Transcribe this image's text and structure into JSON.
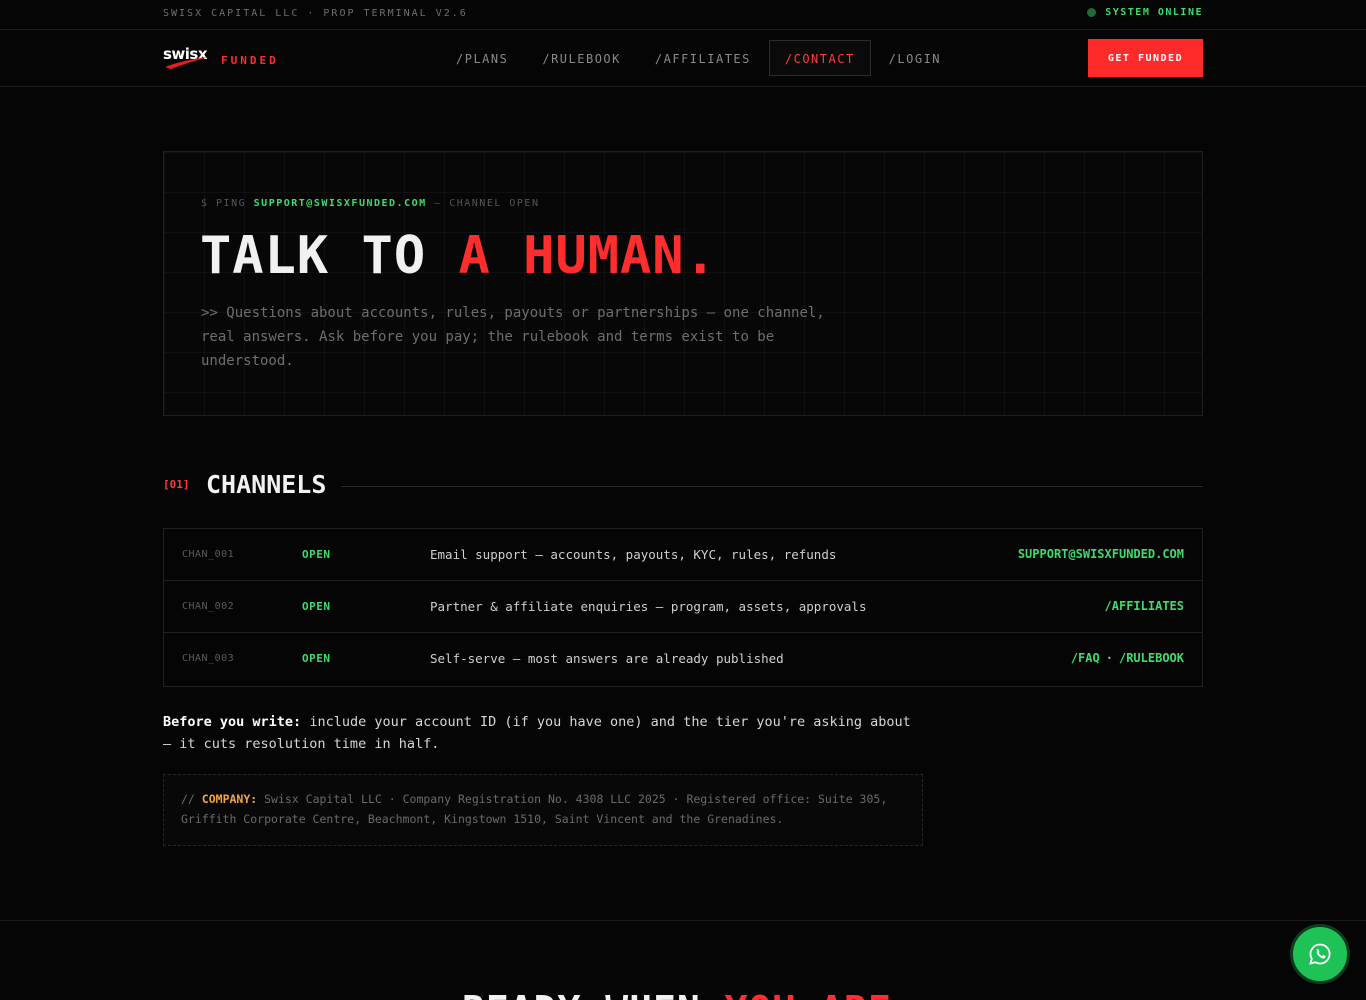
{
  "topbar": {
    "company": "SWISX CAPITAL LLC · PROP TERMINAL V2.6",
    "status": "SYSTEM ONLINE"
  },
  "nav": {
    "logo_word": "swisx",
    "logo_sub": "FUNDED",
    "links": [
      "/PLANS",
      "/RULEBOOK",
      "/AFFILIATES",
      "/CONTACT",
      "/LOGIN"
    ],
    "active": "/CONTACT",
    "cta": "GET FUNDED"
  },
  "hero": {
    "ping_prefix": "$ PING",
    "ping_email": "SUPPORT@SWISXFUNDED.COM",
    "ping_suffix": "— CHANNEL OPEN",
    "title_white": "TALK TO",
    "title_red": "A HUMAN.",
    "lede": ">> Questions about accounts, rules, payouts or partnerships — one channel, real answers. Ask before you pay; the rulebook and terms exist to be understood."
  },
  "channels": {
    "num": "[01]",
    "title": "CHANNELS",
    "rows": [
      {
        "id": "CHAN_001",
        "status": "OPEN",
        "desc": "Email support — accounts, payouts, KYC, rules, refunds",
        "link": "SUPPORT@SWISXFUNDED.COM"
      },
      {
        "id": "CHAN_002",
        "status": "OPEN",
        "desc": "Partner & affiliate enquiries — program, assets, approvals",
        "link": "/AFFILIATES"
      },
      {
        "id": "CHAN_003",
        "status": "OPEN",
        "desc": "Self-serve — most answers are already published",
        "link_a": "/FAQ",
        "link_sep": "·",
        "link_b": "/RULEBOOK"
      }
    ]
  },
  "note": {
    "bold": "Before you write:",
    "text": "include your account ID (if you have one) and the tier you're asking about — it cuts resolution time in half."
  },
  "company": {
    "prefix": "//",
    "label": "COMPANY:",
    "text": "Swisx Capital LLC · Company Registration No. 4308 LLC 2025 · Registered office: Suite 305, Griffith Corporate Centre, Beachmont, Kingstown 1510, Saint Vincent and the Grenadines."
  },
  "footer_cta": {
    "white": "READY WHEN",
    "red": "YOU ARE"
  },
  "colors": {
    "accent_red": "#ff2d2d",
    "accent_green": "#3ddc6b",
    "whatsapp": "#1fc256"
  },
  "icons": {
    "fab": "whatsapp-icon"
  }
}
